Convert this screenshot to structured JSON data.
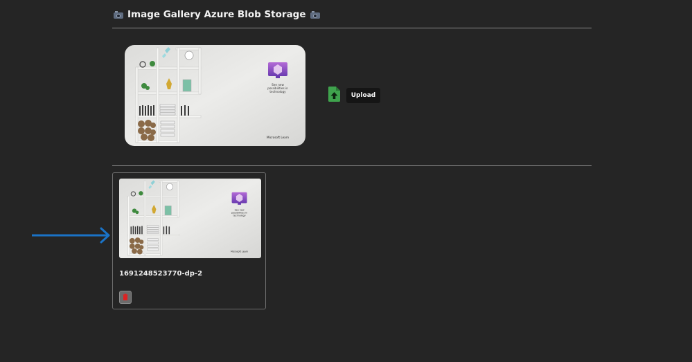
{
  "page": {
    "title": "Image Gallery Azure Blob Storage",
    "title_icon": "camera-icon"
  },
  "upload": {
    "file_icon": "file-upload-icon",
    "button_label": "Upload",
    "preview_text": {
      "tagline_line1": "See new",
      "tagline_line2": "possibilities in",
      "tagline_line3": "technology",
      "brand": "Microsoft Learn"
    }
  },
  "gallery": {
    "items": [
      {
        "name": "1691248523770-dp-2",
        "delete_icon": "trash-icon"
      }
    ]
  },
  "colors": {
    "background": "#252525",
    "upload_icon": "#3fa34d",
    "delete_icon": "#e02020",
    "annotation_arrow": "#1a73c7"
  }
}
